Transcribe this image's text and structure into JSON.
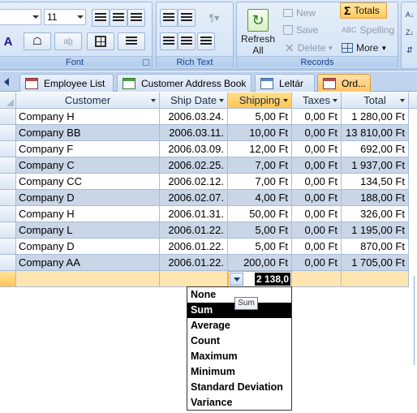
{
  "ribbon": {
    "font_size": "11",
    "font_group_label": "Font",
    "richtext_group_label": "Rich Text",
    "records_group_label": "Records",
    "refresh_label": "Refresh",
    "refresh_sub": "All",
    "new_label": "New",
    "save_label": "Save",
    "delete_label": "Delete",
    "totals_label": "Totals",
    "spelling_label": "Spelling",
    "more_label": "More"
  },
  "tabs": [
    {
      "label": "Employee List",
      "icon": "form-icon"
    },
    {
      "label": "Customer Address Book",
      "icon": "table-icon"
    },
    {
      "label": "Leltár",
      "icon": "table-icon"
    },
    {
      "label": "Ord...",
      "icon": "form-icon"
    }
  ],
  "columns": [
    "Customer",
    "Ship Date",
    "Shipping",
    "Taxes",
    "Total"
  ],
  "rows": [
    {
      "customer": "Company H",
      "ship_date": "2006.03.24.",
      "shipping": "5,00 Ft",
      "taxes": "0,00 Ft",
      "total": "1 280,00 Ft"
    },
    {
      "customer": "Company BB",
      "ship_date": "2006.03.11.",
      "shipping": "10,00 Ft",
      "taxes": "0,00 Ft",
      "total": "13 810,00 Ft"
    },
    {
      "customer": "Company F",
      "ship_date": "2006.03.09.",
      "shipping": "12,00 Ft",
      "taxes": "0,00 Ft",
      "total": "692,00 Ft"
    },
    {
      "customer": "Company C",
      "ship_date": "2006.02.25.",
      "shipping": "7,00 Ft",
      "taxes": "0,00 Ft",
      "total": "1 937,00 Ft"
    },
    {
      "customer": "Company CC",
      "ship_date": "2006.02.12.",
      "shipping": "7,00 Ft",
      "taxes": "0,00 Ft",
      "total": "134,50 Ft"
    },
    {
      "customer": "Company D",
      "ship_date": "2006.02.07.",
      "shipping": "4,00 Ft",
      "taxes": "0,00 Ft",
      "total": "188,00 Ft"
    },
    {
      "customer": "Company H",
      "ship_date": "2006.01.31.",
      "shipping": "50,00 Ft",
      "taxes": "0,00 Ft",
      "total": "326,00 Ft"
    },
    {
      "customer": "Company L",
      "ship_date": "2006.01.22.",
      "shipping": "5,00 Ft",
      "taxes": "0,00 Ft",
      "total": "1 195,00 Ft"
    },
    {
      "customer": "Company D",
      "ship_date": "2006.01.22.",
      "shipping": "5,00 Ft",
      "taxes": "0,00 Ft",
      "total": "870,00 Ft"
    },
    {
      "customer": "Company AA",
      "ship_date": "2006.01.22.",
      "shipping": "200,00 Ft",
      "taxes": "0,00 Ft",
      "total": "1 705,00 Ft"
    }
  ],
  "total_row": {
    "shipping_value": "2 138,0"
  },
  "total_options": [
    "None",
    "Sum",
    "Average",
    "Count",
    "Maximum",
    "Minimum",
    "Standard Deviation",
    "Variance"
  ],
  "selected_option": "Sum",
  "tooltip": "Sum",
  "colors": {
    "accent": "#ffc552",
    "alt_row": "#c9d6e7",
    "ribbon": "#c5d9f1"
  }
}
